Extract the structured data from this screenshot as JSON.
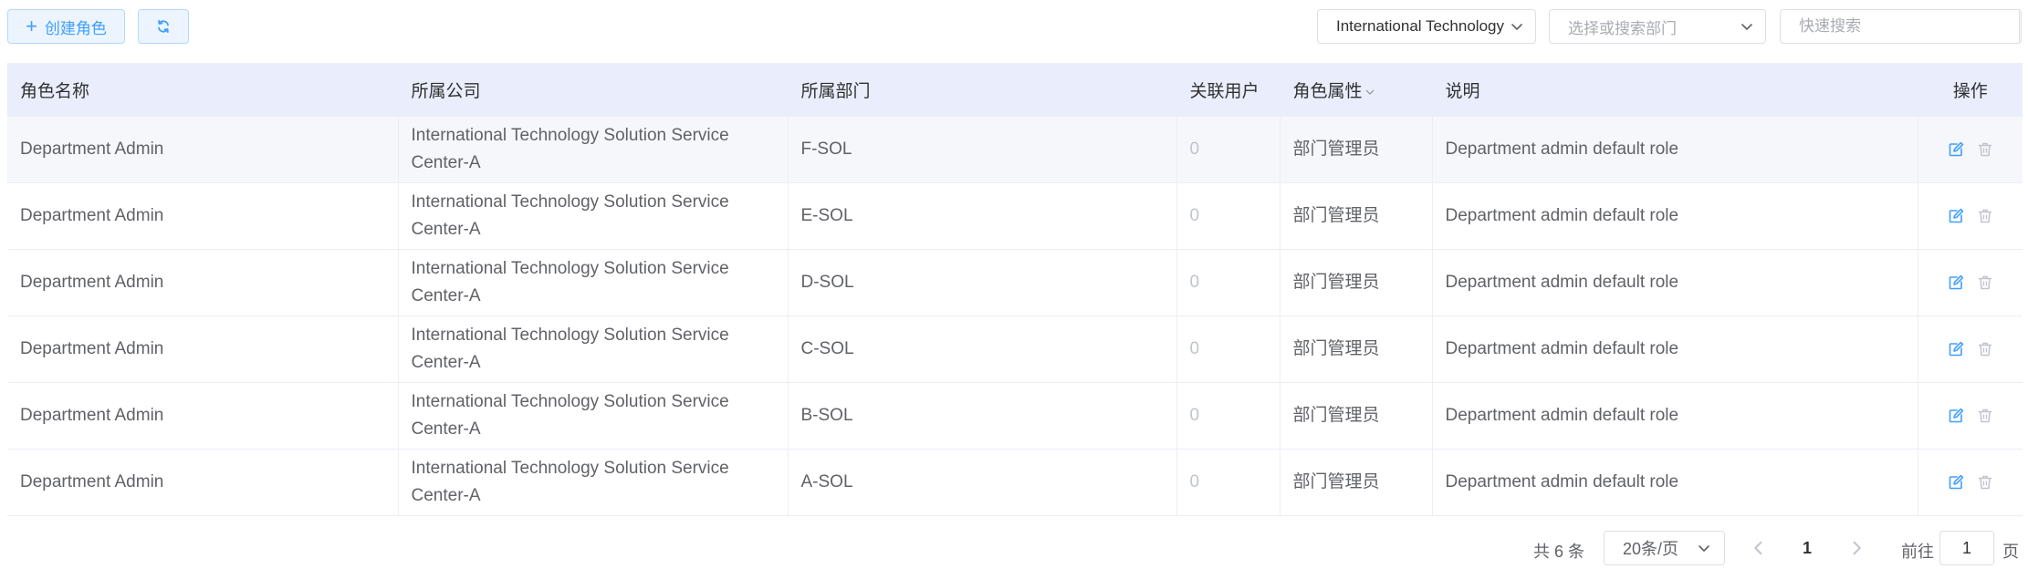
{
  "toolbar": {
    "create_button": "创建角色",
    "company_select": "International Technology Solution Service Center-A",
    "department_placeholder": "选择或搜索部门",
    "search_placeholder": "快速搜索"
  },
  "table": {
    "columns": [
      "角色名称",
      "所属公司",
      "所属部门",
      "关联用户",
      "角色属性",
      "说明",
      "操作"
    ],
    "rows": [
      {
        "name": "Department Admin",
        "company": "International Technology Solution Service Center-A",
        "department": "F-SOL",
        "users": "0",
        "attribute": "部门管理员",
        "description": "Department admin default role"
      },
      {
        "name": "Department Admin",
        "company": "International Technology Solution Service Center-A",
        "department": "E-SOL",
        "users": "0",
        "attribute": "部门管理员",
        "description": "Department admin default role"
      },
      {
        "name": "Department Admin",
        "company": "International Technology Solution Service Center-A",
        "department": "D-SOL",
        "users": "0",
        "attribute": "部门管理员",
        "description": "Department admin default role"
      },
      {
        "name": "Department Admin",
        "company": "International Technology Solution Service Center-A",
        "department": "C-SOL",
        "users": "0",
        "attribute": "部门管理员",
        "description": "Department admin default role"
      },
      {
        "name": "Department Admin",
        "company": "International Technology Solution Service Center-A",
        "department": "B-SOL",
        "users": "0",
        "attribute": "部门管理员",
        "description": "Department admin default role"
      },
      {
        "name": "Department Admin",
        "company": "International Technology Solution Service Center-A",
        "department": "A-SOL",
        "users": "0",
        "attribute": "部门管理员",
        "description": "Department admin default role"
      }
    ]
  },
  "pagination": {
    "total": "共 6 条",
    "page_size": "20条/页",
    "current_page": "1",
    "goto_label": "前往",
    "goto_value": "1",
    "page_suffix": "页"
  },
  "icons": {
    "create": "plus-icon",
    "refresh": "refresh-icon",
    "dropdown": "chevron-down-icon",
    "search": "search-icon",
    "edit": "edit-icon",
    "delete": "trash-icon",
    "prev": "chevron-left-icon",
    "next": "chevron-right-icon"
  },
  "colors": {
    "primary": "#409eff",
    "header_bg": "#eaeefc",
    "row_highlight": "#f5f7fa",
    "disabled": "#c0c4cc"
  }
}
